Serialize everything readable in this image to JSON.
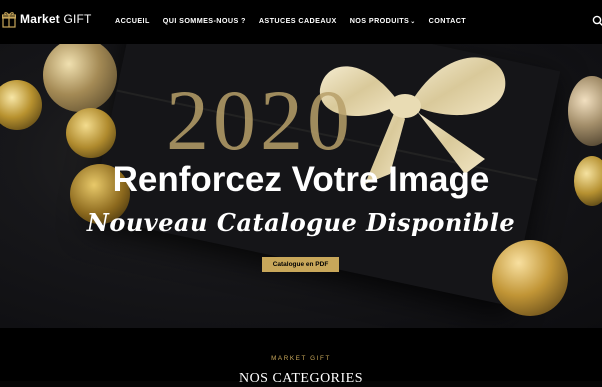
{
  "header": {
    "logo_brand": "Market",
    "logo_suffix": "GIFT",
    "nav": [
      {
        "label": "ACCUEIL"
      },
      {
        "label": "QUI SOMMES-NOUS ?"
      },
      {
        "label": "ASTUCES CADEAUX"
      },
      {
        "label": "NOS PRODUITS",
        "has_dropdown": true
      },
      {
        "label": "CONTACT"
      }
    ]
  },
  "hero": {
    "year": "2020",
    "title": "Renforcez Votre Image",
    "subtitle": "Nouveau Catalogue Disponible",
    "cta_label": "Catalogue en PDF"
  },
  "section": {
    "eyebrow": "MARKET GIFT",
    "title": "NOS CATEGORIES"
  },
  "colors": {
    "accent_gold": "#c8a75a",
    "background": "#000000"
  },
  "icons": [
    "gift-icon",
    "search-icon",
    "chevron-down-icon"
  ]
}
